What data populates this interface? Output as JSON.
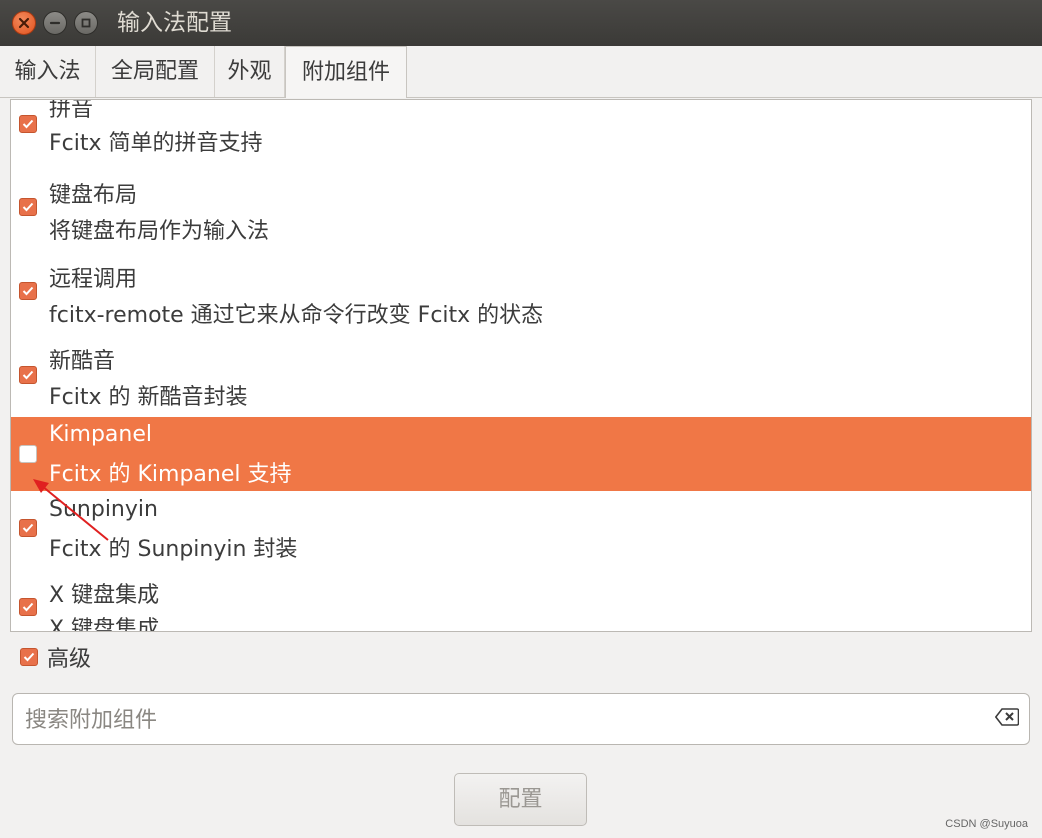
{
  "window": {
    "title": "输入法配置"
  },
  "tabs": [
    {
      "label": "输入法"
    },
    {
      "label": "全局配置"
    },
    {
      "label": "外观"
    },
    {
      "label": "附加组件"
    }
  ],
  "addons": [
    {
      "name": "拼音",
      "desc": "Fcitx 简单的拼音支持",
      "checked": true
    },
    {
      "name": "键盘布局",
      "desc": "将键盘布局作为输入法",
      "checked": true
    },
    {
      "name": "远程调用",
      "desc": "fcitx-remote 通过它来从命令行改变 Fcitx 的状态",
      "checked": true
    },
    {
      "name": "新酷音",
      "desc": "Fcitx 的 新酷音封装",
      "checked": true
    },
    {
      "name": "Kimpanel",
      "desc": "Fcitx 的 Kimpanel 支持",
      "checked": false,
      "selected": true
    },
    {
      "name": "Sunpinyin",
      "desc": "Fcitx 的 Sunpinyin 封装",
      "checked": true
    },
    {
      "name": "X 键盘集成",
      "desc": "X 键盘集成",
      "checked": true
    }
  ],
  "advanced": {
    "label": "高级",
    "checked": true
  },
  "search": {
    "placeholder": "搜索附加组件",
    "value": ""
  },
  "buttons": {
    "configure": "配置"
  },
  "watermark": "CSDN @Suyuoa",
  "colors": {
    "accent": "#f07746",
    "checkbox": "#e8714a",
    "titlebar": "#3c3b37"
  }
}
